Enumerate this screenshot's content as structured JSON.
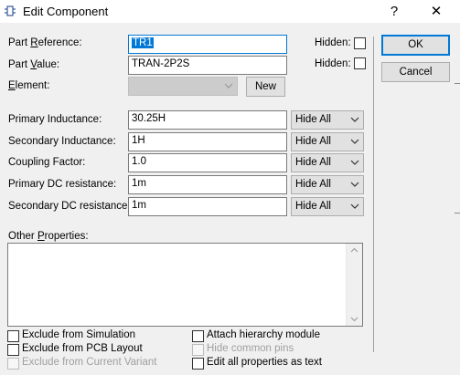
{
  "window": {
    "title": "Edit Component",
    "help_glyph": "?",
    "close_glyph": "✕",
    "icon": "schematic-component-icon"
  },
  "fields": {
    "part_reference": {
      "label": "Part Reference:",
      "value": "TR1",
      "hidden_label": "Hidden:",
      "hidden": false
    },
    "part_value": {
      "label": "Part Value:",
      "value": "TRAN-2P2S",
      "hidden_label": "Hidden:",
      "hidden": false
    },
    "element": {
      "label": "Element:",
      "value": "",
      "new_label": "New"
    }
  },
  "properties": [
    {
      "label": "Primary Inductance:",
      "value": "30.25H",
      "visibility": "Hide All"
    },
    {
      "label": "Secondary Inductance:",
      "value": "1H",
      "visibility": "Hide All"
    },
    {
      "label": "Coupling Factor:",
      "value": "1.0",
      "visibility": "Hide All"
    },
    {
      "label": "Primary DC resistance:",
      "value": "1m",
      "visibility": "Hide All"
    },
    {
      "label": "Secondary DC resistance:",
      "value": "1m",
      "visibility": "Hide All"
    }
  ],
  "other_properties": {
    "label": "Other Properties:",
    "value": ""
  },
  "buttons": {
    "ok": "OK",
    "cancel": "Cancel"
  },
  "options_left": [
    {
      "label": "Exclude from Simulation",
      "checked": false,
      "enabled": true
    },
    {
      "label": "Exclude from PCB Layout",
      "checked": false,
      "enabled": true
    },
    {
      "label": "Exclude from Current Variant",
      "checked": false,
      "enabled": false
    }
  ],
  "options_right": [
    {
      "label": "Attach hierarchy module",
      "checked": false,
      "enabled": true
    },
    {
      "label": "Hide common pins",
      "checked": false,
      "enabled": false
    },
    {
      "label": "Edit all properties as text",
      "checked": false,
      "enabled": true
    }
  ],
  "colors": {
    "accent": "#0078d7",
    "background": "#f0f0f0",
    "disabled_text": "#a0a0a0"
  }
}
